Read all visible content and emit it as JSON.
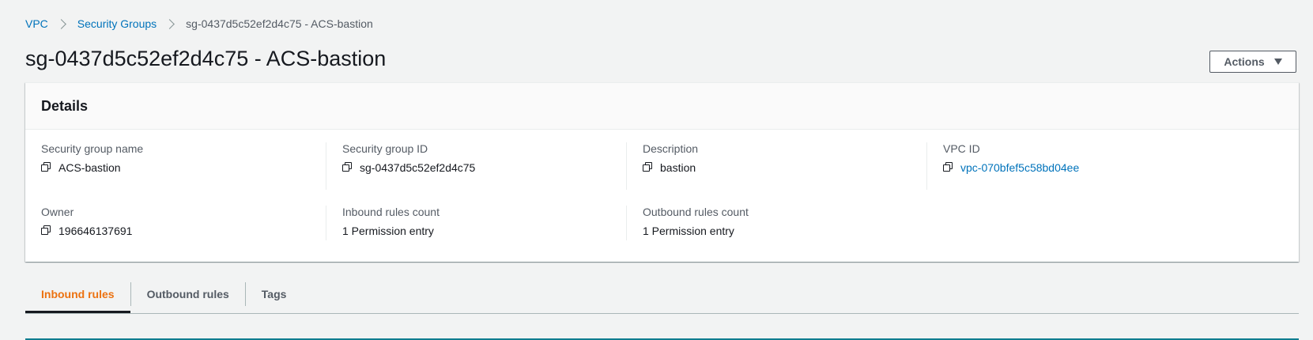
{
  "breadcrumb": {
    "items": [
      {
        "label": "VPC"
      },
      {
        "label": "Security Groups"
      },
      {
        "label": "sg-0437d5c52ef2d4c75 - ACS-bastion"
      }
    ]
  },
  "header": {
    "title": "sg-0437d5c52ef2d4c75 - ACS-bastion",
    "actions_label": "Actions"
  },
  "details": {
    "title": "Details",
    "fields": [
      {
        "label": "Security group name",
        "value": "ACS-bastion",
        "copyable": true
      },
      {
        "label": "Security group ID",
        "value": "sg-0437d5c52ef2d4c75",
        "copyable": true
      },
      {
        "label": "Description",
        "value": "bastion",
        "copyable": true
      },
      {
        "label": "VPC ID",
        "value": "vpc-070bfef5c58bd04ee",
        "copyable": true,
        "link": true
      },
      {
        "label": "Owner",
        "value": "196646137691",
        "copyable": true
      },
      {
        "label": "Inbound rules count",
        "value": "1 Permission entry",
        "copyable": false
      },
      {
        "label": "Outbound rules count",
        "value": "1 Permission entry",
        "copyable": false
      }
    ]
  },
  "tabs": [
    {
      "label": "Inbound rules",
      "active": true
    },
    {
      "label": "Outbound rules",
      "active": false
    },
    {
      "label": "Tags",
      "active": false
    }
  ],
  "colors": {
    "link": "#0073bb",
    "active_tab": "#ec7211",
    "background": "#f2f3f3"
  },
  "icons": {
    "copy": "copy-icon",
    "actions_caret": "caret-down-icon",
    "breadcrumb_separator": "chevron-right-icon"
  }
}
